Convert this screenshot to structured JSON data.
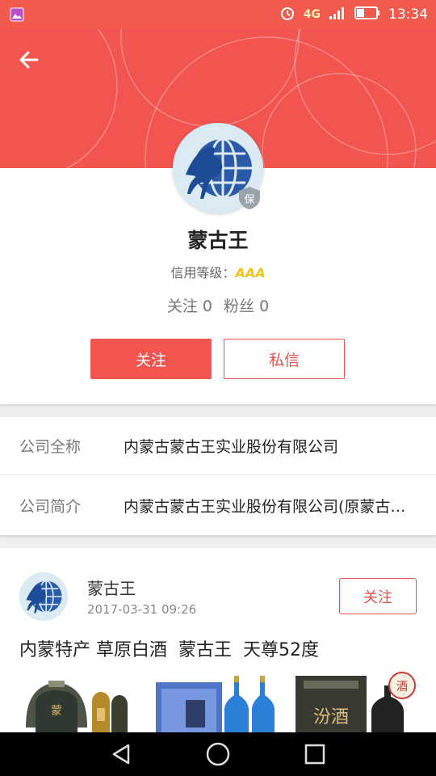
{
  "status_bar": {
    "time": "13:34",
    "network": "4G",
    "icons": [
      "gallery-icon",
      "alarm-icon",
      "signal-icon",
      "battery-icon"
    ]
  },
  "header": {
    "back_icon": "arrow-left-icon",
    "background_color": "#f25450"
  },
  "profile": {
    "name": "蒙古王",
    "badge": "保",
    "credit_label": "信用等级：",
    "credit_level": "AAA",
    "stats": {
      "follow_label": "关注",
      "follow_count": "0",
      "fans_label": "粉丝",
      "fans_count": "0"
    },
    "follow_button": "关注",
    "message_button": "私信"
  },
  "info": {
    "rows": [
      {
        "label": "公司全称",
        "value": "内蒙古蒙古王实业股份有限公司"
      },
      {
        "label": "公司简介",
        "value": "内蒙古蒙古王实业股份有限公司(原蒙古王酒业股份有限公司)"
      }
    ]
  },
  "post": {
    "author": "蒙古王",
    "time": "2017-03-31 09:26",
    "follow_button": "关注",
    "title": "内蒙特产 草原白酒  蒙古王  天尊52度",
    "image_labels": [
      "蒙",
      "汾酒",
      "酒"
    ]
  },
  "nav_bar": {
    "icons": [
      "back-triangle-icon",
      "home-circle-icon",
      "recents-square-icon"
    ]
  },
  "colors": {
    "accent": "#f25450",
    "credit": "#f2c21a"
  }
}
